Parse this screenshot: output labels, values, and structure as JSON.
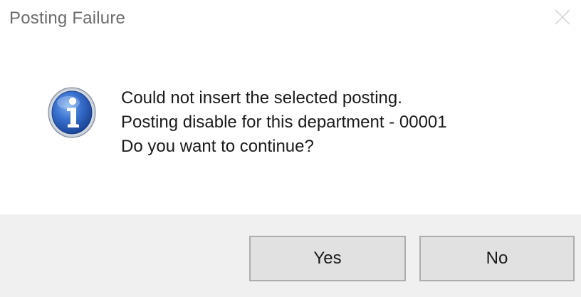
{
  "dialog": {
    "title": "Posting Failure",
    "message_lines": [
      "Could not insert the selected posting.",
      "Posting disable for this department - 00001",
      "Do you want to continue?"
    ],
    "icon": "info-icon",
    "buttons": {
      "yes_label": "Yes",
      "no_label": "No"
    }
  },
  "colors": {
    "footer_bg": "#f0f0f0",
    "button_bg": "#e1e1e1",
    "icon_blue": "#2f64c4"
  }
}
